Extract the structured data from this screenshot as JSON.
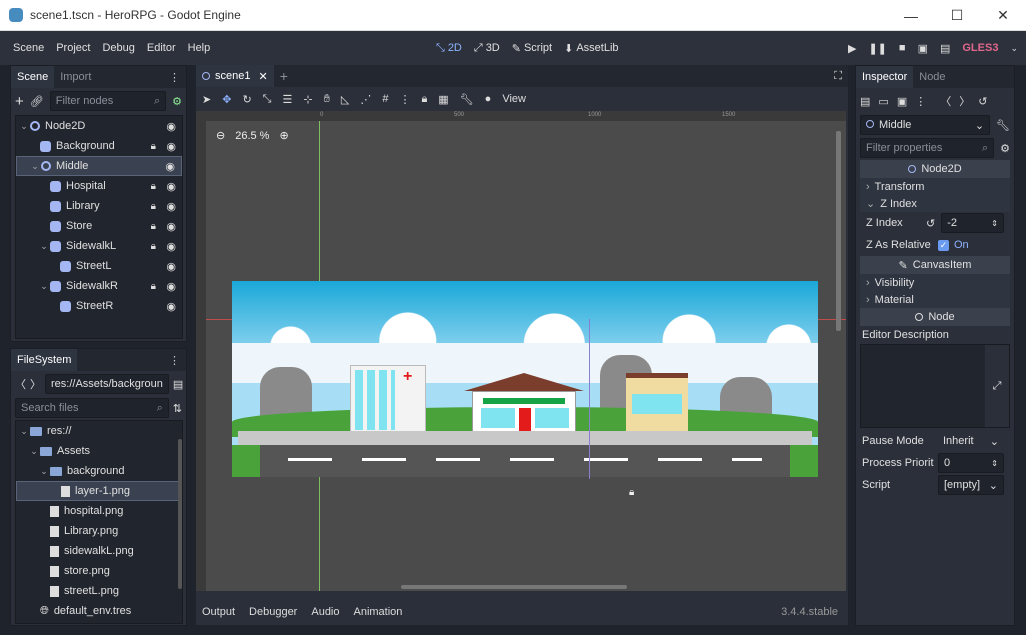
{
  "window": {
    "title": "scene1.tscn - HeroRPG - Godot Engine",
    "minimize": "—",
    "maximize": "☐",
    "close": "✕"
  },
  "menu": [
    "Scene",
    "Project",
    "Debug",
    "Editor",
    "Help"
  ],
  "main_screens": [
    {
      "label": "2D",
      "icon": "2d-icon",
      "active": true
    },
    {
      "label": "3D",
      "icon": "3d-icon",
      "active": false
    },
    {
      "label": "Script",
      "icon": "script-icon",
      "active": false
    },
    {
      "label": "AssetLib",
      "icon": "assetlib-icon",
      "active": false
    }
  ],
  "renderer": "GLES3",
  "scene_dock": {
    "tabs": [
      "Scene",
      "Import"
    ],
    "filter_placeholder": "Filter nodes",
    "nodes": [
      {
        "label": "Node2D",
        "depth": 0,
        "type": "node",
        "arrow": "v",
        "lock": false
      },
      {
        "label": "Background",
        "depth": 1,
        "type": "sprite",
        "arrow": "",
        "lock": true
      },
      {
        "label": "Middle",
        "depth": 1,
        "type": "node",
        "arrow": "v",
        "lock": false,
        "selected": true
      },
      {
        "label": "Hospital",
        "depth": 2,
        "type": "sprite",
        "arrow": "",
        "lock": true
      },
      {
        "label": "Library",
        "depth": 2,
        "type": "sprite",
        "arrow": "",
        "lock": true
      },
      {
        "label": "Store",
        "depth": 2,
        "type": "sprite",
        "arrow": "",
        "lock": true
      },
      {
        "label": "SidewalkL",
        "depth": 2,
        "type": "sprite",
        "arrow": "v",
        "lock": true
      },
      {
        "label": "StreetL",
        "depth": 3,
        "type": "sprite",
        "arrow": "",
        "lock": false
      },
      {
        "label": "SidewalkR",
        "depth": 2,
        "type": "sprite",
        "arrow": "v",
        "lock": true
      },
      {
        "label": "StreetR",
        "depth": 3,
        "type": "sprite",
        "arrow": "",
        "lock": false
      }
    ]
  },
  "filesystem": {
    "tab": "FileSystem",
    "path": "res://Assets/backgroun",
    "search_placeholder": "Search files",
    "items": [
      {
        "label": "res://",
        "depth": 0,
        "kind": "folder",
        "arrow": "v"
      },
      {
        "label": "Assets",
        "depth": 1,
        "kind": "folder",
        "arrow": "v"
      },
      {
        "label": "background",
        "depth": 2,
        "kind": "folder",
        "arrow": "v"
      },
      {
        "label": "layer-1.png",
        "depth": 3,
        "kind": "image",
        "arrow": "",
        "selected": true
      },
      {
        "label": "hospital.png",
        "depth": 2,
        "kind": "image",
        "arrow": ""
      },
      {
        "label": "Library.png",
        "depth": 2,
        "kind": "image",
        "arrow": ""
      },
      {
        "label": "sidewalkL.png",
        "depth": 2,
        "kind": "image",
        "arrow": ""
      },
      {
        "label": "store.png",
        "depth": 2,
        "kind": "image",
        "arrow": ""
      },
      {
        "label": "streetL.png",
        "depth": 2,
        "kind": "image",
        "arrow": ""
      },
      {
        "label": "default_env.tres",
        "depth": 1,
        "kind": "env",
        "arrow": ""
      }
    ]
  },
  "editor": {
    "scene_tab": "scene1",
    "toolbar_view": "View",
    "zoom": "26.5 %",
    "ruler_ticks": [
      "0",
      "500",
      "1000",
      "1500"
    ]
  },
  "bottom_panel": {
    "tabs": [
      "Output",
      "Debugger",
      "Audio",
      "Animation"
    ],
    "version": "3.4.4.stable"
  },
  "inspector": {
    "tabs": [
      "Inspector",
      "Node"
    ],
    "selected_node": "Middle",
    "filter_placeholder": "Filter properties",
    "sections": {
      "node2d": "Node2D",
      "canvasitem": "CanvasItem",
      "node": "Node"
    },
    "groups": {
      "transform": "Transform",
      "zindex": "Z Index",
      "visibility": "Visibility",
      "material": "Material"
    },
    "props": {
      "z_index_label": "Z Index",
      "z_index_value": "-2",
      "z_relative_label": "Z As Relative",
      "z_relative_value": "On",
      "editor_desc_label": "Editor Description",
      "pause_label": "Pause Mode",
      "pause_value": "Inherit",
      "priority_label": "Process Priorit",
      "priority_value": "0",
      "script_label": "Script",
      "script_value": "[empty]"
    }
  }
}
